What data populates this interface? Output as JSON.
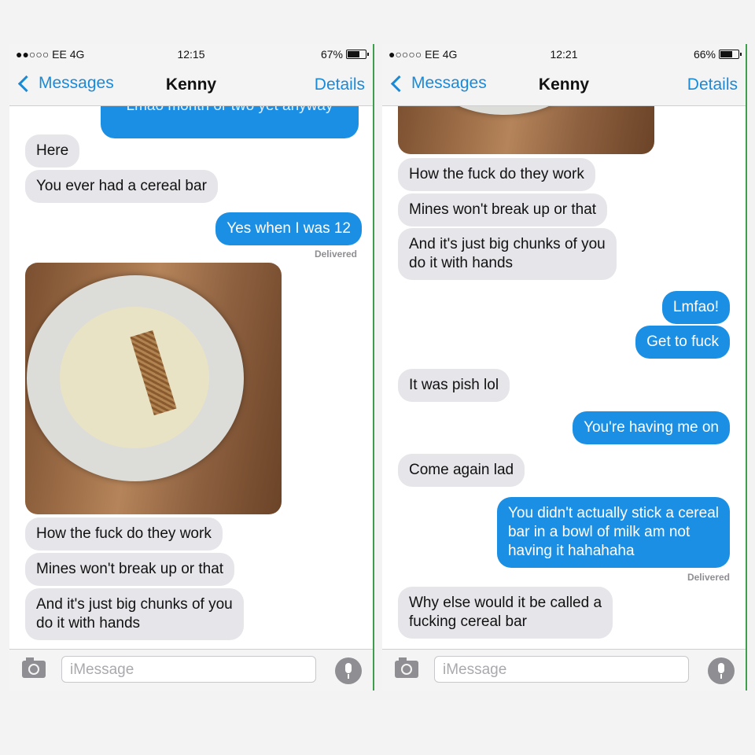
{
  "left": {
    "status": {
      "carrier": "●●○○○ EE  4G",
      "time": "12:15",
      "battery": "67%",
      "battery_level": 0.67
    },
    "nav": {
      "back": "Messages",
      "title": "Kenny",
      "details": "Details"
    },
    "top_cut_text": "Lmao month or two yet anyway",
    "messages": {
      "m1": "Here",
      "m2": "You ever had a cereal bar",
      "m3": "Yes when I was 12",
      "m4": "How the fuck do they work",
      "m5": "Mines won't break up or that",
      "m6": "And it's just big chunks of you\ndo it with hands"
    },
    "delivered": "Delivered",
    "input_placeholder": "iMessage"
  },
  "right": {
    "status": {
      "carrier": "●○○○○ EE  4G",
      "time": "12:21",
      "battery": "66%",
      "battery_level": 0.66
    },
    "nav": {
      "back": "Messages",
      "title": "Kenny",
      "details": "Details"
    },
    "messages": {
      "m1": "How the fuck do they work",
      "m2": "Mines won't break up or that",
      "m3": "And it's just big chunks of you\ndo it with hands",
      "m4": "Lmfao!",
      "m5": "Get to fuck",
      "m6": "It was pish lol",
      "m7": "You're having me on",
      "m8": "Come again lad",
      "m9": "You didn't actually stick a cereal\nbar in a bowl of milk am not\nhaving it hahahaha",
      "m10": "Why else would it be called a\nfucking cereal bar"
    },
    "delivered": "Delivered",
    "input_placeholder": "iMessage"
  },
  "colors": {
    "sent": "#1a8fe3",
    "received": "#e5e5ea",
    "accent": "#1a8ad8"
  },
  "icons": [
    "camera-icon",
    "microphone-icon",
    "back-chevron-icon",
    "battery-icon"
  ]
}
